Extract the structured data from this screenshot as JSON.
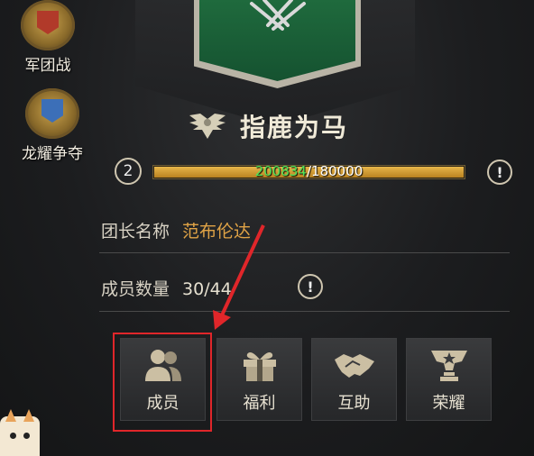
{
  "side_events": [
    {
      "label": "军团战"
    },
    {
      "label": "龙耀争夺"
    }
  ],
  "guild": {
    "name": "指鹿为马",
    "level": "2",
    "exp_current": "200834",
    "exp_total": "/180000",
    "exp_progress": 1.0
  },
  "info": {
    "leader_key": "团长名称",
    "leader_value": "范布伦达",
    "members_key": "成员数量",
    "members_value": "30/44"
  },
  "info_icon_glyph": "!",
  "tabs": [
    {
      "label": "成员",
      "icon": "members-icon"
    },
    {
      "label": "福利",
      "icon": "gift-icon"
    },
    {
      "label": "互助",
      "icon": "handshake-icon"
    },
    {
      "label": "荣耀",
      "icon": "trophy-icon"
    }
  ],
  "colors": {
    "accent_gold": "#e0a346",
    "exp_current_green": "#4fe35a",
    "highlight_red": "#e0262a",
    "emblem_green": "#1f6a3d"
  }
}
